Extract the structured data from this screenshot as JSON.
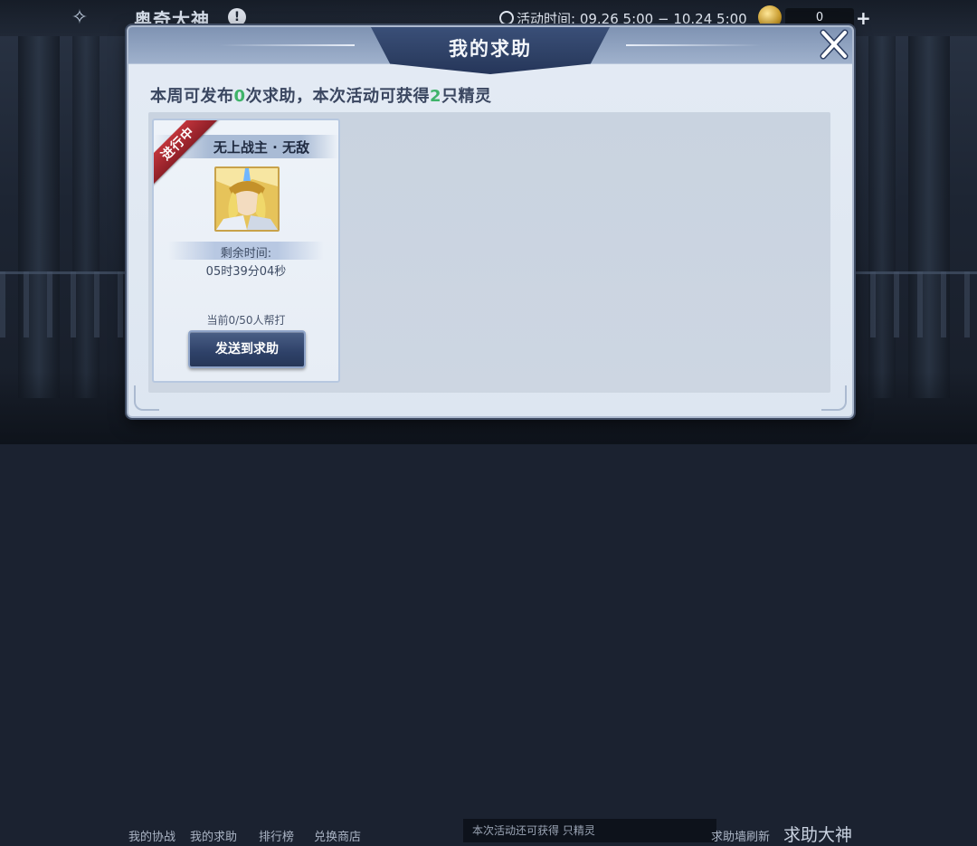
{
  "background_page": {
    "title": "奥奇大神",
    "activity_time": "活动时间: 09.26 5:00 − 10.24 5:00",
    "coin_count": "0",
    "plus_label": "+",
    "info_label": "!",
    "bottom_tabs": [
      "我的协战",
      "我的求助",
      "排行榜",
      "兑换商店"
    ],
    "bottom_hint": "本次活动还可获得 只精灵",
    "refresh_label": "求助墙刷新",
    "big_button": "求助大神"
  },
  "dialog": {
    "title": "我的求助",
    "summary": {
      "part1": "本周可发布",
      "count_publish": "0",
      "part2": "次求助，本次活动可获得",
      "count_spirits": "2",
      "part3": "只精灵"
    },
    "cards": [
      {
        "status": "进行中",
        "name": "无上战主 · 无敌",
        "remaining_label": "剩余时间:",
        "remaining_value": "05时39分04秒",
        "progress": "当前0/50人帮打",
        "button": "发送到求助"
      }
    ]
  },
  "colors": {
    "accent_green": "#3fb36a",
    "ribbon_red": "#b02e36",
    "header_navy": "#2c3e62"
  }
}
